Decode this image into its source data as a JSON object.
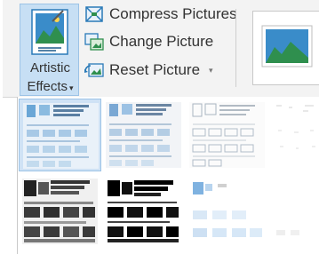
{
  "artistic_effects": {
    "line1": "Artistic",
    "line2": "Effects",
    "dropdown_icon": "chevron-down-icon"
  },
  "commands": [
    {
      "label": "Compress Pictures",
      "icon": "compress-pictures-icon"
    },
    {
      "label": "Change Picture",
      "icon": "change-picture-icon"
    },
    {
      "label": "Reset Picture",
      "icon": "reset-picture-icon"
    }
  ],
  "reset_dropdown_arrow": "▾",
  "gallery": {
    "tiles": [
      "none",
      "pencil-grayscale",
      "pencil-sketch",
      "line-drawing",
      "chalk-sketch",
      "photocopy",
      "glow-edges",
      "blur"
    ],
    "selected_index": 0
  },
  "colors": {
    "accent": "#c7dff4",
    "accent_border": "#9cc3e6",
    "text": "#333333"
  }
}
